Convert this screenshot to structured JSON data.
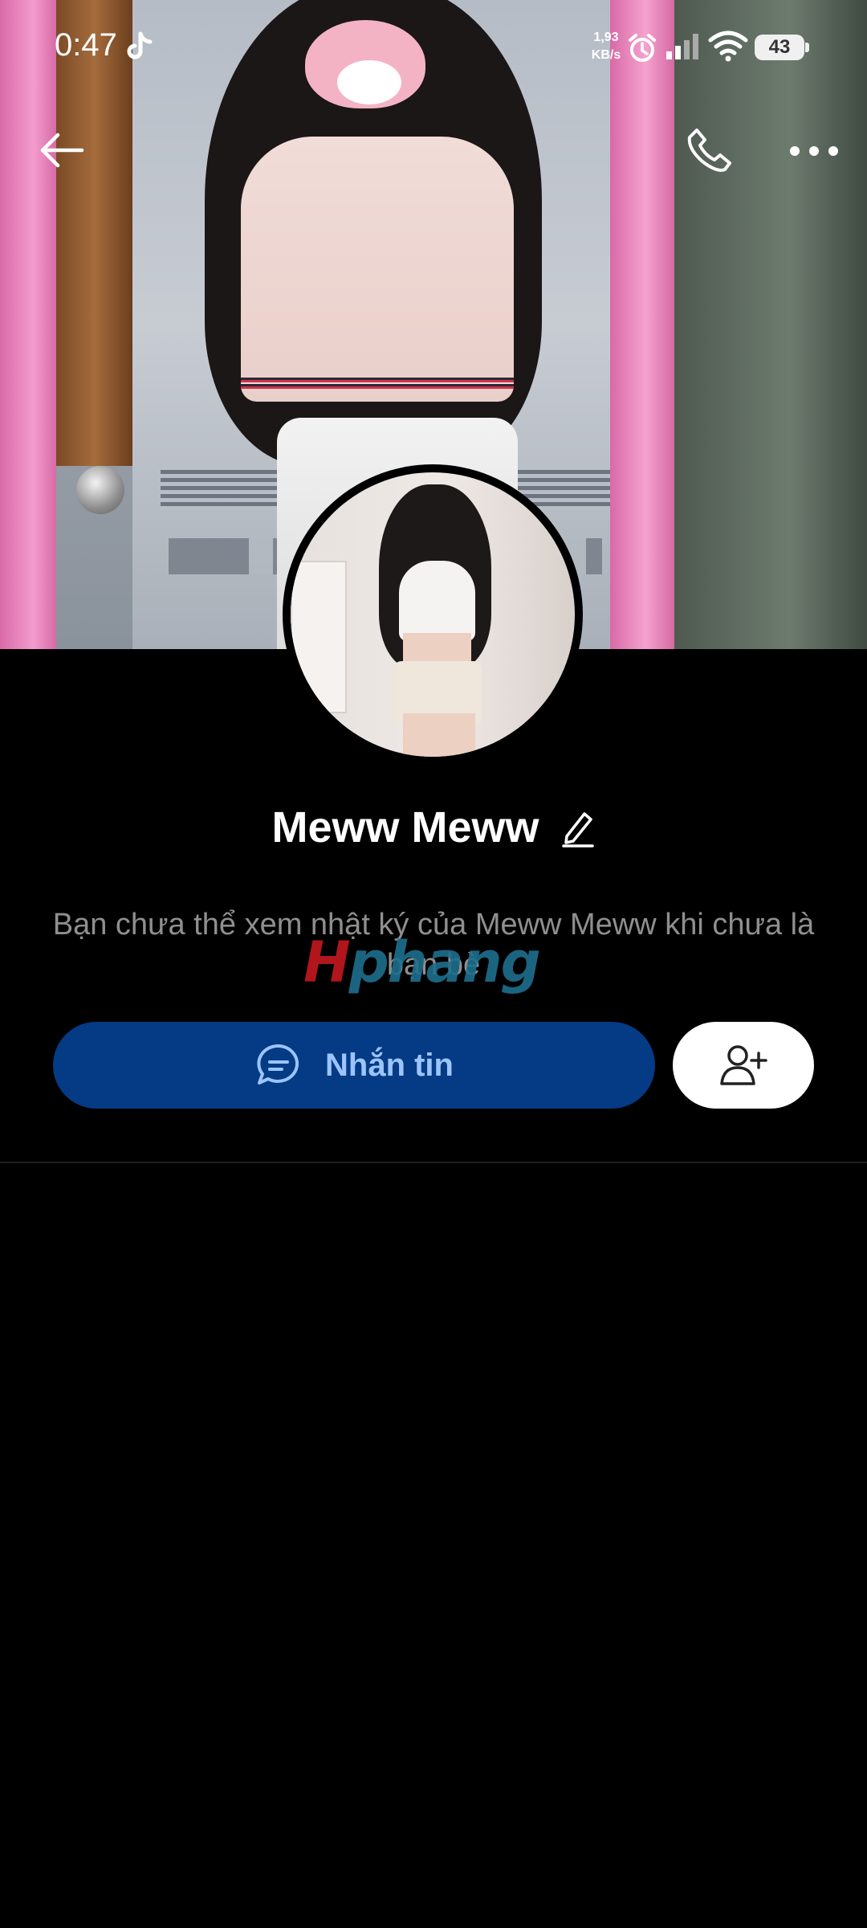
{
  "status_bar": {
    "time": "0:47",
    "net_speed_value": "1,93",
    "net_speed_unit": "KB/s",
    "battery": "43",
    "icons": [
      "tiktok-icon",
      "alarm-icon",
      "signal-icon",
      "wifi-icon",
      "battery-icon"
    ]
  },
  "header": {
    "icons": [
      "back-arrow-icon",
      "phone-icon",
      "more-dots-icon"
    ]
  },
  "profile": {
    "name": "Meww Meww",
    "notice": "Bạn chưa thể xem nhật ký của Meww Meww khi chưa là bạn bè"
  },
  "watermark": {
    "first_letter": "H",
    "rest": "phang"
  },
  "actions": {
    "message_label": "Nhắn tin",
    "message_icon": "chat-bubble-icon",
    "add_friend_icon": "add-person-icon"
  },
  "colors": {
    "background": "#000000",
    "message_button_bg": "#053b85",
    "message_button_text": "#9cc4ff",
    "add_friend_bg": "#ffffff",
    "notice_text": "#8f8f8f"
  }
}
